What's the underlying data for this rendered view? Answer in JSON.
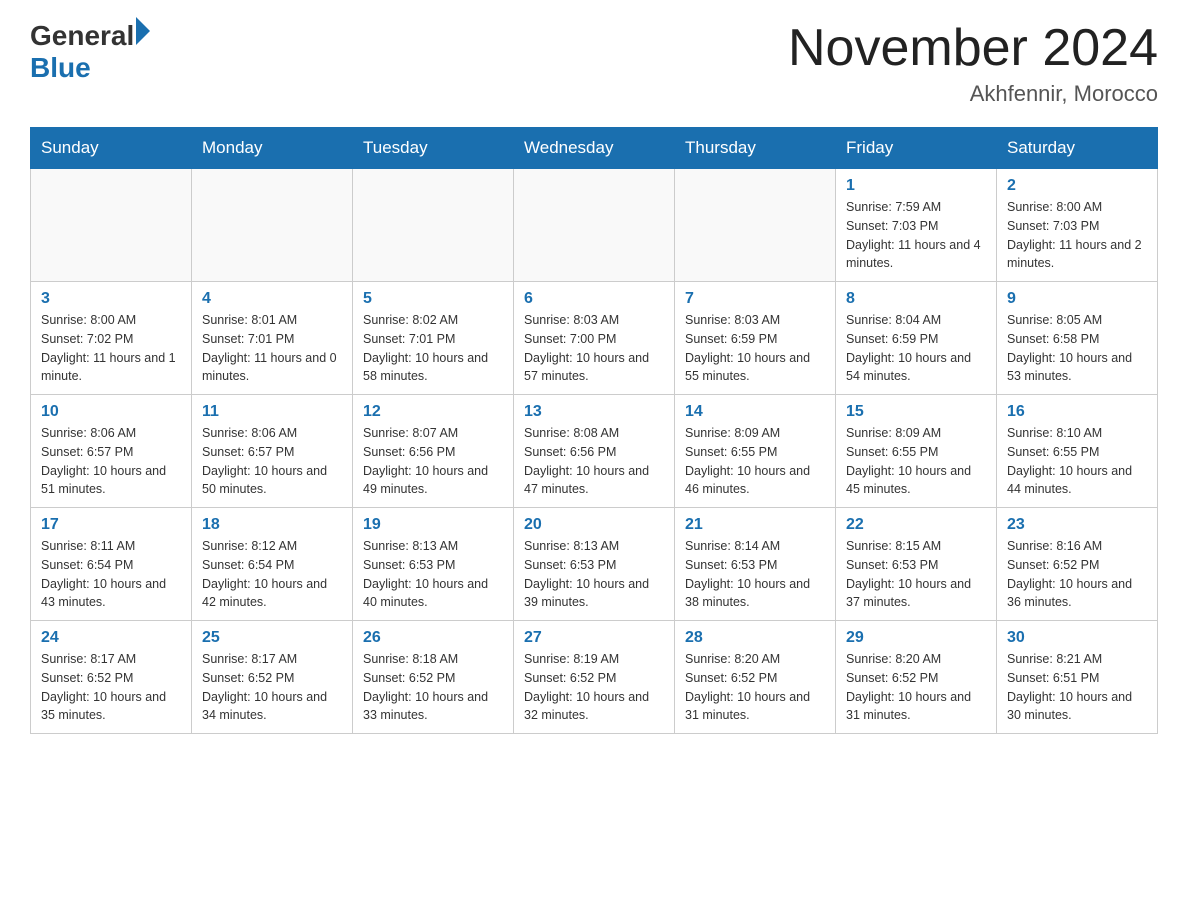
{
  "header": {
    "logo_general": "General",
    "logo_blue": "Blue",
    "month_title": "November 2024",
    "location": "Akhfennir, Morocco"
  },
  "weekdays": [
    "Sunday",
    "Monday",
    "Tuesday",
    "Wednesday",
    "Thursday",
    "Friday",
    "Saturday"
  ],
  "weeks": [
    [
      {
        "day": "",
        "info": ""
      },
      {
        "day": "",
        "info": ""
      },
      {
        "day": "",
        "info": ""
      },
      {
        "day": "",
        "info": ""
      },
      {
        "day": "",
        "info": ""
      },
      {
        "day": "1",
        "info": "Sunrise: 7:59 AM\nSunset: 7:03 PM\nDaylight: 11 hours and 4 minutes."
      },
      {
        "day": "2",
        "info": "Sunrise: 8:00 AM\nSunset: 7:03 PM\nDaylight: 11 hours and 2 minutes."
      }
    ],
    [
      {
        "day": "3",
        "info": "Sunrise: 8:00 AM\nSunset: 7:02 PM\nDaylight: 11 hours and 1 minute."
      },
      {
        "day": "4",
        "info": "Sunrise: 8:01 AM\nSunset: 7:01 PM\nDaylight: 11 hours and 0 minutes."
      },
      {
        "day": "5",
        "info": "Sunrise: 8:02 AM\nSunset: 7:01 PM\nDaylight: 10 hours and 58 minutes."
      },
      {
        "day": "6",
        "info": "Sunrise: 8:03 AM\nSunset: 7:00 PM\nDaylight: 10 hours and 57 minutes."
      },
      {
        "day": "7",
        "info": "Sunrise: 8:03 AM\nSunset: 6:59 PM\nDaylight: 10 hours and 55 minutes."
      },
      {
        "day": "8",
        "info": "Sunrise: 8:04 AM\nSunset: 6:59 PM\nDaylight: 10 hours and 54 minutes."
      },
      {
        "day": "9",
        "info": "Sunrise: 8:05 AM\nSunset: 6:58 PM\nDaylight: 10 hours and 53 minutes."
      }
    ],
    [
      {
        "day": "10",
        "info": "Sunrise: 8:06 AM\nSunset: 6:57 PM\nDaylight: 10 hours and 51 minutes."
      },
      {
        "day": "11",
        "info": "Sunrise: 8:06 AM\nSunset: 6:57 PM\nDaylight: 10 hours and 50 minutes."
      },
      {
        "day": "12",
        "info": "Sunrise: 8:07 AM\nSunset: 6:56 PM\nDaylight: 10 hours and 49 minutes."
      },
      {
        "day": "13",
        "info": "Sunrise: 8:08 AM\nSunset: 6:56 PM\nDaylight: 10 hours and 47 minutes."
      },
      {
        "day": "14",
        "info": "Sunrise: 8:09 AM\nSunset: 6:55 PM\nDaylight: 10 hours and 46 minutes."
      },
      {
        "day": "15",
        "info": "Sunrise: 8:09 AM\nSunset: 6:55 PM\nDaylight: 10 hours and 45 minutes."
      },
      {
        "day": "16",
        "info": "Sunrise: 8:10 AM\nSunset: 6:55 PM\nDaylight: 10 hours and 44 minutes."
      }
    ],
    [
      {
        "day": "17",
        "info": "Sunrise: 8:11 AM\nSunset: 6:54 PM\nDaylight: 10 hours and 43 minutes."
      },
      {
        "day": "18",
        "info": "Sunrise: 8:12 AM\nSunset: 6:54 PM\nDaylight: 10 hours and 42 minutes."
      },
      {
        "day": "19",
        "info": "Sunrise: 8:13 AM\nSunset: 6:53 PM\nDaylight: 10 hours and 40 minutes."
      },
      {
        "day": "20",
        "info": "Sunrise: 8:13 AM\nSunset: 6:53 PM\nDaylight: 10 hours and 39 minutes."
      },
      {
        "day": "21",
        "info": "Sunrise: 8:14 AM\nSunset: 6:53 PM\nDaylight: 10 hours and 38 minutes."
      },
      {
        "day": "22",
        "info": "Sunrise: 8:15 AM\nSunset: 6:53 PM\nDaylight: 10 hours and 37 minutes."
      },
      {
        "day": "23",
        "info": "Sunrise: 8:16 AM\nSunset: 6:52 PM\nDaylight: 10 hours and 36 minutes."
      }
    ],
    [
      {
        "day": "24",
        "info": "Sunrise: 8:17 AM\nSunset: 6:52 PM\nDaylight: 10 hours and 35 minutes."
      },
      {
        "day": "25",
        "info": "Sunrise: 8:17 AM\nSunset: 6:52 PM\nDaylight: 10 hours and 34 minutes."
      },
      {
        "day": "26",
        "info": "Sunrise: 8:18 AM\nSunset: 6:52 PM\nDaylight: 10 hours and 33 minutes."
      },
      {
        "day": "27",
        "info": "Sunrise: 8:19 AM\nSunset: 6:52 PM\nDaylight: 10 hours and 32 minutes."
      },
      {
        "day": "28",
        "info": "Sunrise: 8:20 AM\nSunset: 6:52 PM\nDaylight: 10 hours and 31 minutes."
      },
      {
        "day": "29",
        "info": "Sunrise: 8:20 AM\nSunset: 6:52 PM\nDaylight: 10 hours and 31 minutes."
      },
      {
        "day": "30",
        "info": "Sunrise: 8:21 AM\nSunset: 6:51 PM\nDaylight: 10 hours and 30 minutes."
      }
    ]
  ]
}
